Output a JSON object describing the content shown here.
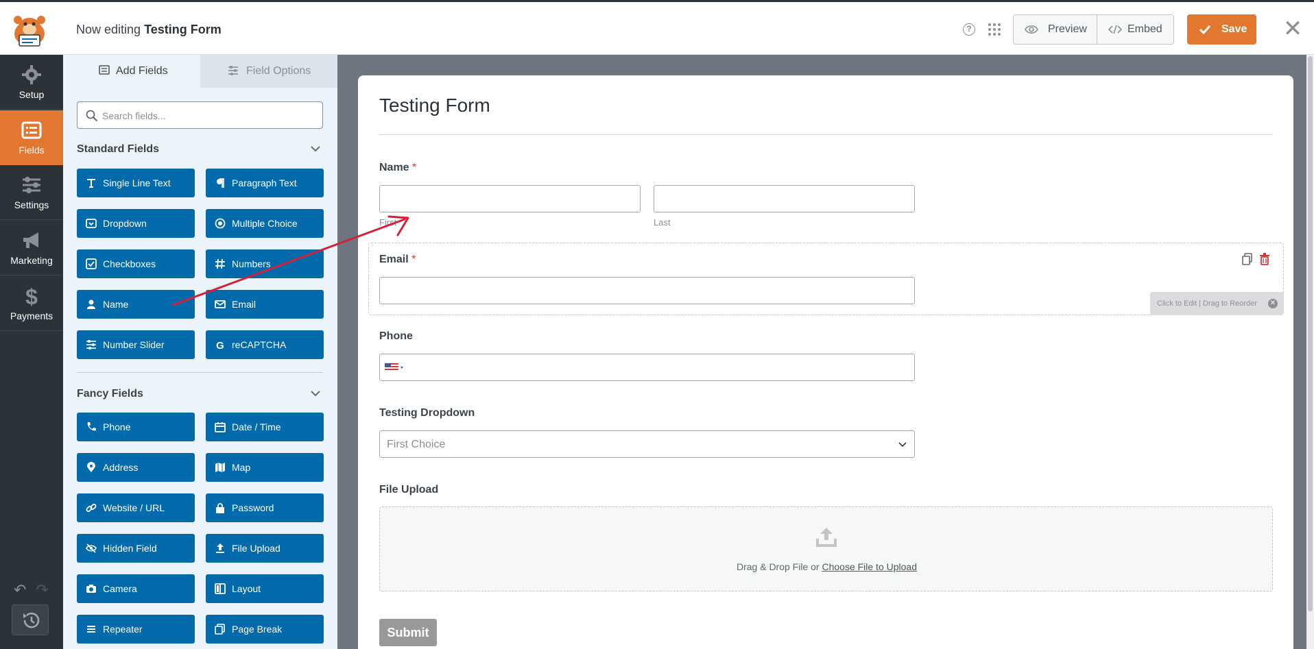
{
  "header": {
    "now_editing": "Now editing",
    "form_name": "Testing Form",
    "help_icon_text": "?",
    "preview_label": "Preview",
    "embed_label": "Embed",
    "save_label": "Save",
    "close_icon": "close-icon"
  },
  "nav": {
    "items": [
      {
        "label": "Setup",
        "icon": "gear-icon"
      },
      {
        "label": "Fields",
        "icon": "fields-icon",
        "active": true
      },
      {
        "label": "Settings",
        "icon": "sliders-icon"
      },
      {
        "label": "Marketing",
        "icon": "megaphone-icon"
      },
      {
        "label": "Payments",
        "icon": "dollar-icon"
      }
    ]
  },
  "panel": {
    "tabs": {
      "add": "Add Fields",
      "options": "Field Options"
    },
    "search_placeholder": "Search fields...",
    "standard_title": "Standard Fields",
    "standard_fields": [
      "Single Line Text",
      "Paragraph Text",
      "Dropdown",
      "Multiple Choice",
      "Checkboxes",
      "Numbers",
      "Name",
      "Email",
      "Number Slider",
      "reCAPTCHA"
    ],
    "fancy_title": "Fancy Fields",
    "fancy_fields": [
      "Phone",
      "Date / Time",
      "Address",
      "Map",
      "Website / URL",
      "Password",
      "Hidden Field",
      "File Upload",
      "Camera",
      "Layout",
      "Repeater",
      "Page Break"
    ]
  },
  "form": {
    "title": "Testing Form",
    "name_label": "Name",
    "required_mark": "*",
    "first_sublabel": "First",
    "last_sublabel": "Last",
    "email_label": "Email",
    "edit_hint": "Click to Edit | Drag to Reorder",
    "phone_label": "Phone",
    "dropdown_label": "Testing Dropdown",
    "dropdown_value": "First Choice",
    "upload_label": "File Upload",
    "upload_text": "Drag & Drop File or",
    "upload_link": "Choose File to Upload",
    "submit_label": "Submit"
  },
  "colors": {
    "accent": "#e27730",
    "field_button": "#036aab",
    "nav_bg": "#2c3338",
    "annotation_arrow": "#d6203a"
  }
}
